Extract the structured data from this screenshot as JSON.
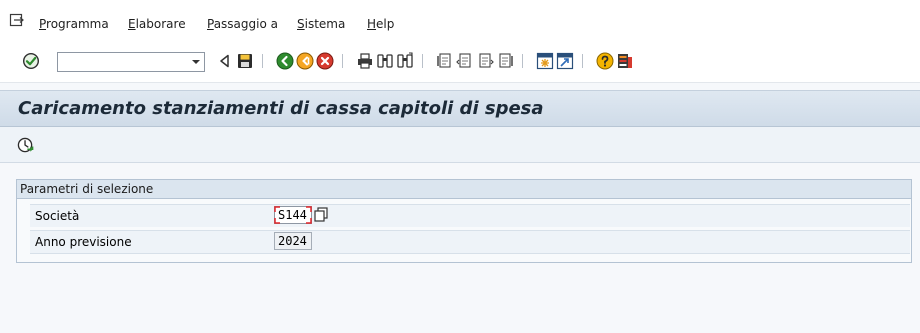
{
  "menu": {
    "items": [
      {
        "id": "programma",
        "mnemonic": "P",
        "rest": "rogramma"
      },
      {
        "id": "elaborare",
        "mnemonic": "E",
        "rest": "laborare"
      },
      {
        "id": "passaggio",
        "mnemonic": "P",
        "rest": "assaggio a"
      },
      {
        "id": "sistema",
        "mnemonic": "S",
        "rest": "istema"
      },
      {
        "id": "help",
        "mnemonic": "H",
        "rest": "elp"
      }
    ]
  },
  "toolbar": {
    "command_field_value": "",
    "icons": [
      "enter-icon",
      "back-triangle-icon",
      "save-icon",
      "back-icon",
      "exit-icon",
      "cancel-icon",
      "print-icon",
      "find-icon",
      "find-next-icon",
      "first-page-icon",
      "previous-page-icon",
      "next-page-icon",
      "last-page-icon",
      "create-session-icon",
      "shortcut-icon",
      "help-icon",
      "layout-icon"
    ]
  },
  "title": "Caricamento stanziamenti di cassa capitoli di spesa",
  "app_toolbar": {
    "icons": [
      "execute-icon"
    ]
  },
  "selection": {
    "group_title": "Parametri di selezione",
    "fields": [
      {
        "label": "Società",
        "value": "S144"
      },
      {
        "label": "Anno previsione",
        "value": "2024"
      }
    ]
  },
  "colors": {
    "title_bar": "#d6e0eb",
    "accent_green": "#2e8b2e",
    "focus_red": "#e0262b"
  }
}
